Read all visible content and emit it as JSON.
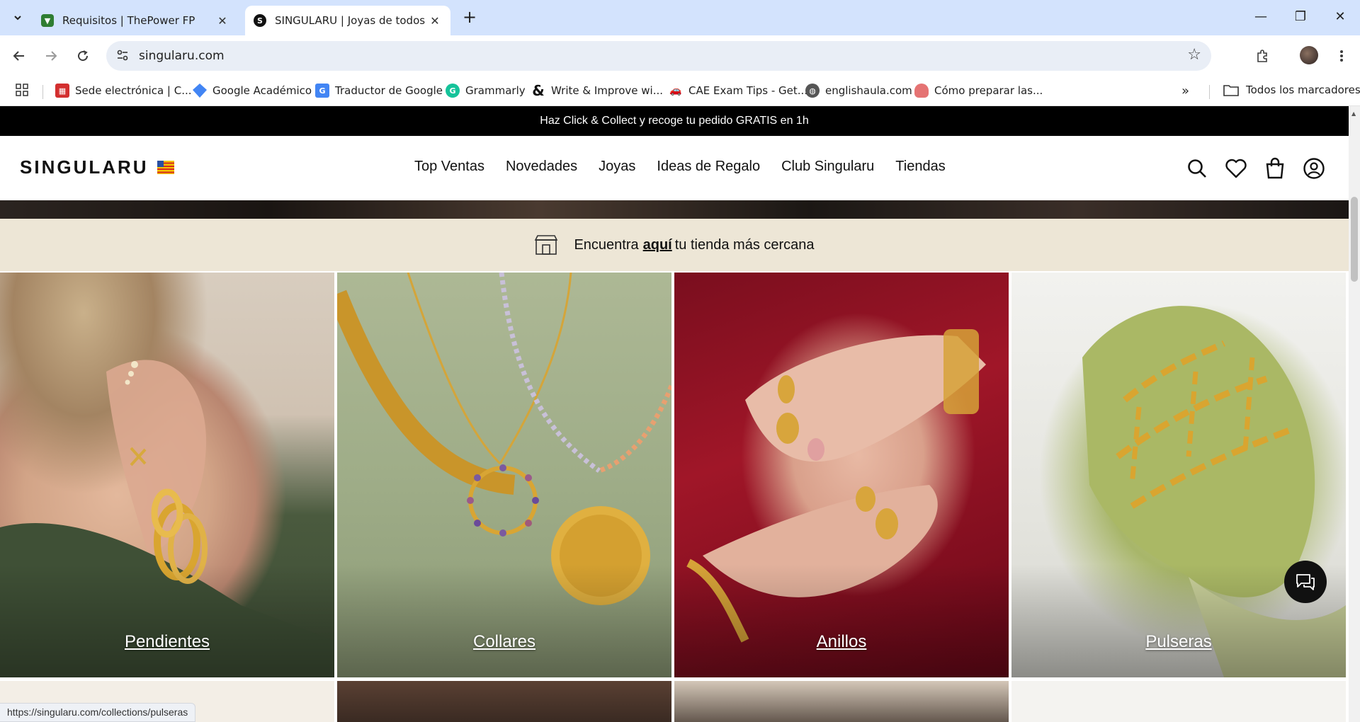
{
  "browser": {
    "tabs": [
      {
        "title": "Requisitos | ThePower FP",
        "active": false,
        "favicon_color": "#2e7d32"
      },
      {
        "title": "SINGULARU | Joyas de todos los",
        "active": true,
        "favicon_color": "#111111"
      }
    ],
    "url": "singularu.com",
    "status_url": "https://singularu.com/collections/pulseras",
    "bookmarks": [
      {
        "label": "Sede electrónica | C...",
        "icon": "madrid-icon",
        "color": "#d32f2f"
      },
      {
        "label": "Google Académico",
        "icon": "scholar-icon",
        "color": "#4285f4"
      },
      {
        "label": "Traductor de Google",
        "icon": "translate-icon",
        "color": "#4285f4"
      },
      {
        "label": "Grammarly",
        "icon": "grammarly-icon",
        "color": "#15c39a"
      },
      {
        "label": "Write & Improve wi...",
        "icon": "ampersand-icon",
        "color": "#111111"
      },
      {
        "label": "CAE Exam Tips - Get...",
        "icon": "car-icon",
        "color": "#666666"
      },
      {
        "label": "englishaula.com",
        "icon": "globe-icon",
        "color": "#555555"
      },
      {
        "label": "Cómo preparar las...",
        "icon": "octopus-icon",
        "color": "#e57373"
      }
    ],
    "all_bookmarks": "Todos los marcadores"
  },
  "site": {
    "announcement": "Haz Click & Collect y recoge tu pedido GRATIS en 1h",
    "logo": "SINGULARU",
    "nav": [
      "Top Ventas",
      "Novedades",
      "Joyas",
      "Ideas de Regalo",
      "Club Singularu",
      "Tiendas"
    ],
    "store_bar": {
      "before": "Encuentra",
      "link": "aquí",
      "after": "tu tienda más cercana"
    },
    "categories": [
      "Pendientes",
      "Collares",
      "Anillos",
      "Pulseras"
    ]
  },
  "colors": {
    "brand_black": "#000000",
    "store_bar_bg": "#ede6d6",
    "tabstrip_bg": "#d3e3fd"
  }
}
